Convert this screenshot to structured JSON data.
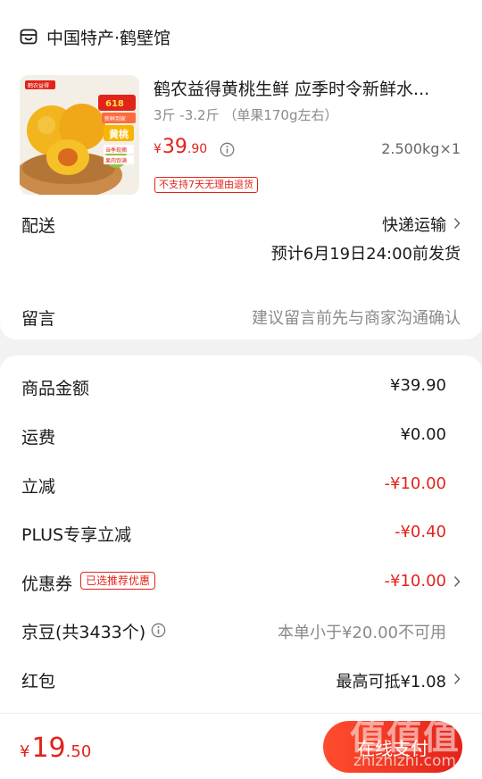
{
  "shop": {
    "icon": "store-icon",
    "name": "中国特产·鹤壁馆"
  },
  "product": {
    "title": "鹤农益得黄桃生鲜 应季时令新鲜水...",
    "spec": "3斤 -3.2斤 （单果170g左右）",
    "price_currency": "¥",
    "price_int": "39",
    "price_dec": ".90",
    "quantity": "2.500kg×1",
    "return_tag": "不支持7天无理由退货",
    "image_text": {
      "brand": "鹤农益得",
      "badge": "618",
      "promo": "新鲜到家",
      "name": "黄桃",
      "tag1": "当季现摘",
      "tag2": "果肉饱满"
    }
  },
  "delivery": {
    "label": "配送",
    "method": "快递运输",
    "estimate": "预计6月19日24:00前发货"
  },
  "note": {
    "label": "留言",
    "placeholder": "建议留言前先与商家沟通确认"
  },
  "summary": [
    {
      "label": "商品金额",
      "value": "¥39.90"
    },
    {
      "label": "运费",
      "value": "¥0.00"
    },
    {
      "label": "立减",
      "value": "-¥10.00"
    },
    {
      "label": "PLUS专享立减",
      "value": "-¥0.40"
    },
    {
      "label": "优惠券",
      "value": "-¥10.00",
      "tag": "已选推荐优惠"
    },
    {
      "label": "京豆(共3433个)",
      "value": "本单小于¥20.00不可用"
    },
    {
      "label": "红包",
      "value": "最高可抵¥1.08"
    }
  ],
  "footer": {
    "total_currency": "¥",
    "total_int": "19",
    "total_dec": ".50",
    "pay_label": "在线支付"
  },
  "watermark": {
    "main": "值值值",
    "sub": "zhizhizhi.com"
  },
  "colors": {
    "accent": "#e2231a",
    "background": "#f2f2f2",
    "card": "#ffffff",
    "muted": "#8a8a8a"
  }
}
